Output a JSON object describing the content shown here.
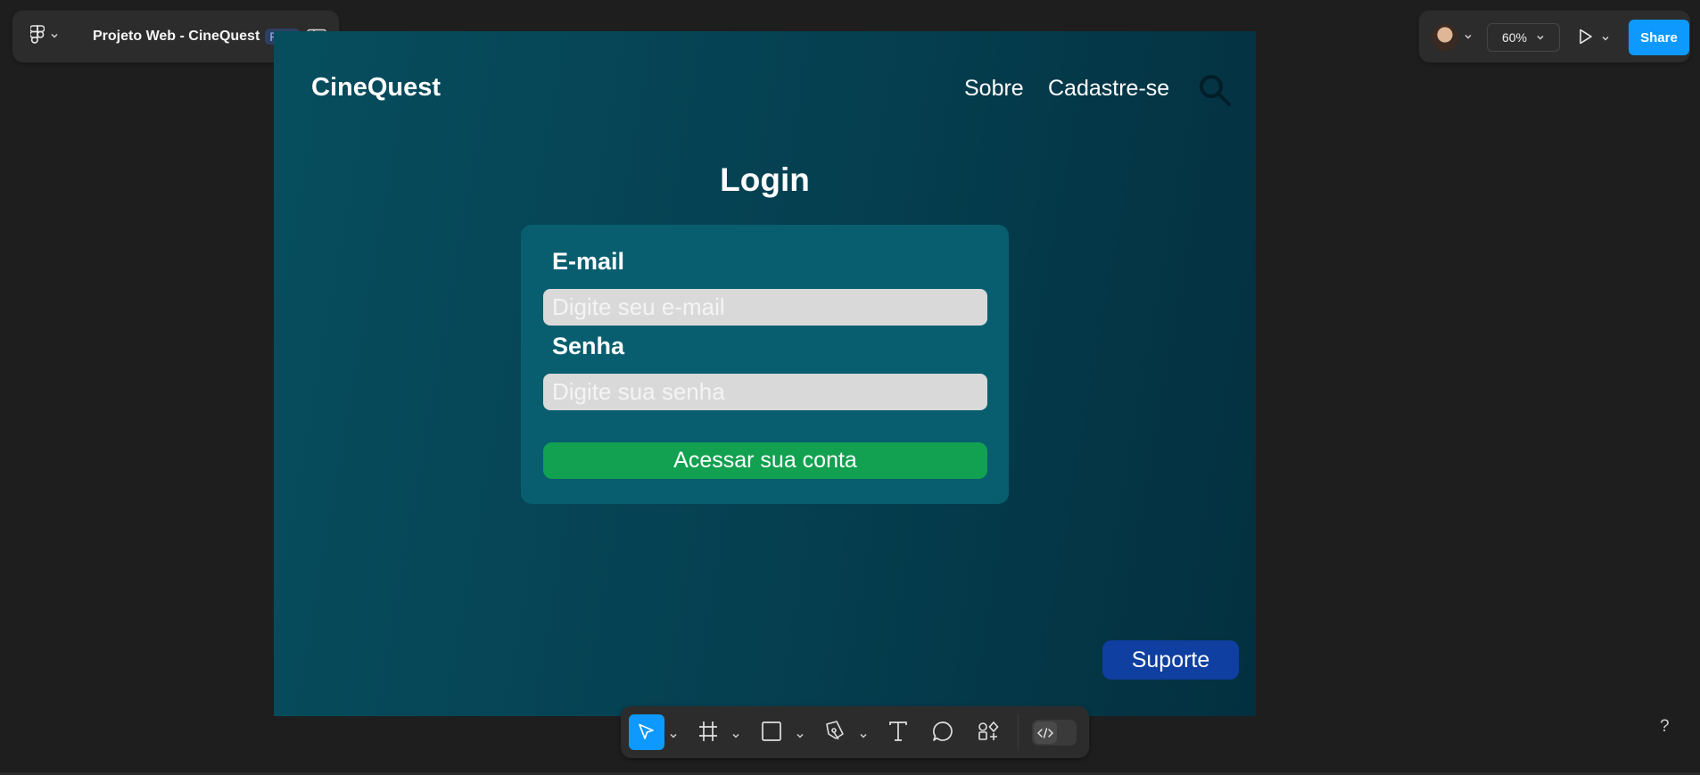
{
  "file": {
    "name": "Projeto Web - CineQuest",
    "plan_badge": "Free"
  },
  "topbar": {
    "zoom": "60%",
    "share_label": "Share"
  },
  "design": {
    "brand": "CineQuest",
    "nav": {
      "about": "Sobre",
      "signup": "Cadastre-se"
    },
    "login": {
      "title": "Login",
      "email_label": "E-mail",
      "email_placeholder": "Digite seu e-mail",
      "password_label": "Senha",
      "password_placeholder": "Digite sua senha",
      "submit_label": "Acessar sua conta"
    },
    "support_label": "Suporte"
  },
  "toolbar": {
    "tools": [
      "move-tool-icon",
      "frame-tool-icon",
      "rectangle-tool-icon",
      "pen-tool-icon",
      "text-tool-icon",
      "comment-tool-icon",
      "actions-icon",
      "dev-mode-icon"
    ]
  },
  "help_label": "?",
  "colors": {
    "app_bg": "#1e1e1e",
    "panel_bg": "#2c2c2c",
    "figma_blue": "#0d99ff",
    "frame_bg_start": "#064e5e",
    "frame_bg_end": "#03303f",
    "card_bg": "#085e6f",
    "input_bg": "#d9d9d9",
    "login_green": "#12a150",
    "support_blue": "#0f3fa0"
  }
}
